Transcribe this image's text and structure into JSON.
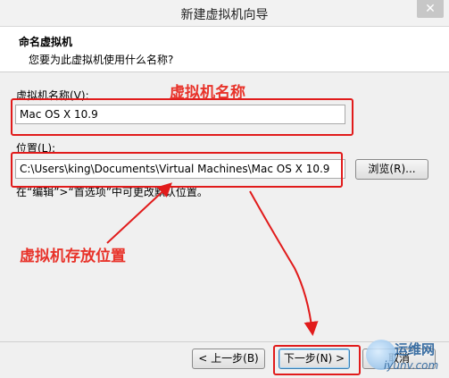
{
  "window": {
    "title": "新建虚拟机向导"
  },
  "header": {
    "title": "命名虚拟机",
    "subtitle": "您要为此虚拟机使用什么名称?"
  },
  "form": {
    "name_label": "虚拟机名称(V):",
    "name_value": "Mac OS X 10.9",
    "location_label": "位置(L):",
    "location_value": "C:\\Users\\king\\Documents\\Virtual Machines\\Mac OS X 10.9",
    "browse_button": "浏览(R)...",
    "hint": "在“编辑”>“首选项”中可更改默认位置。"
  },
  "footer": {
    "back_button": "< 上一步(B)",
    "next_button": "下一步(N) >",
    "cancel_button": "取消"
  },
  "annotations": {
    "name_note": "虚拟机名称",
    "location_note": "虚拟机存放位置",
    "color": "#e11b1b"
  },
  "watermark": {
    "cn": "运维网",
    "en": "iyunv.com"
  }
}
